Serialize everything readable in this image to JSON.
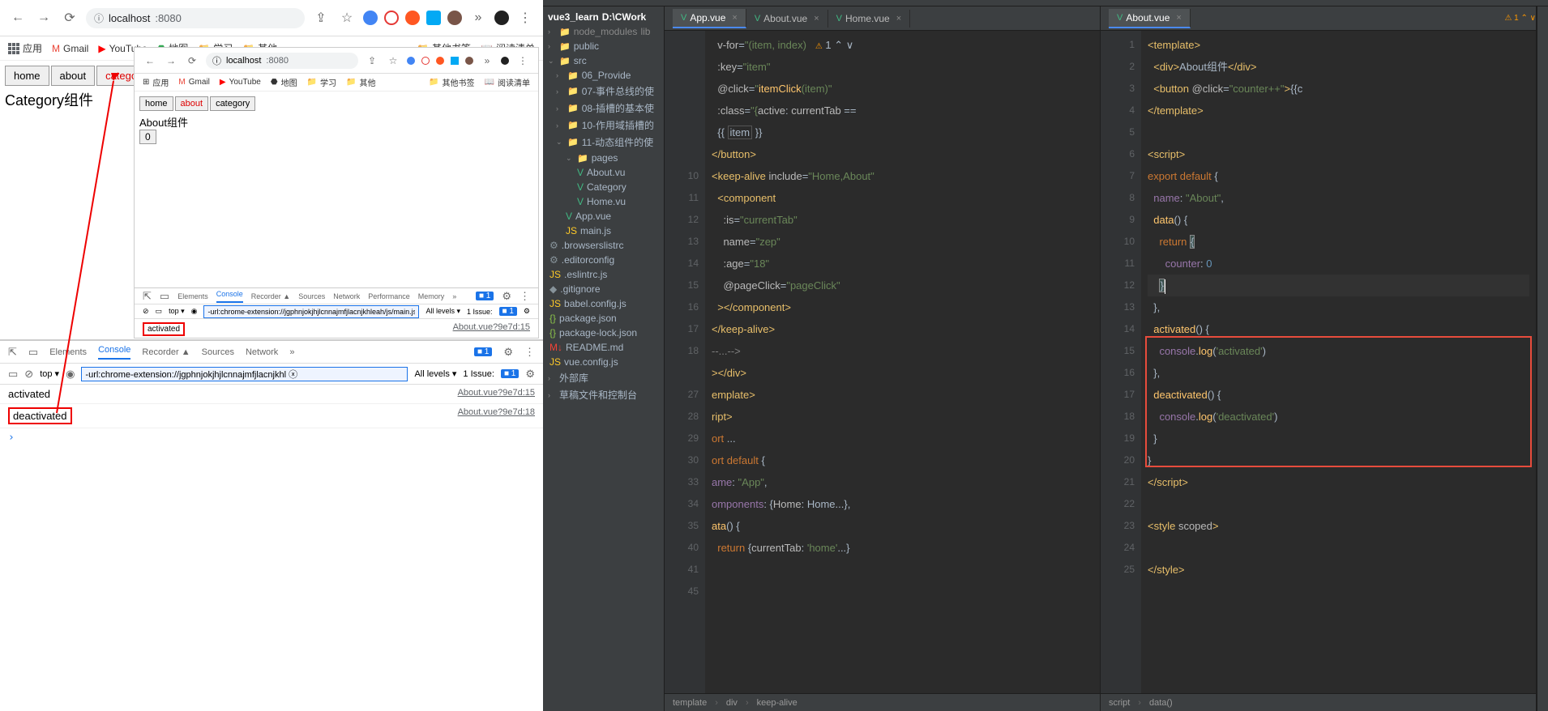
{
  "browser1": {
    "url_prefix": "localhost",
    "url_port": ":8080",
    "info_icon": "ⓘ",
    "bookmarks": {
      "apps": "应用",
      "gmail": "Gmail",
      "youtube": "YouTube",
      "maps": "地图",
      "study": "学习",
      "other": "其他",
      "other_bookmarks": "其他书签",
      "reading_list": "阅读清单"
    },
    "tabs": {
      "home": "home",
      "about": "about",
      "category": "category"
    },
    "page_title": "Category组件"
  },
  "browser2": {
    "url_prefix": "localhost",
    "url_port": ":8080",
    "tabs": {
      "home": "home",
      "about": "about",
      "category": "category"
    },
    "page_title": "About组件",
    "counter": "0",
    "devtools": {
      "tabs": [
        "Elements",
        "Console",
        "Recorder ▲",
        "Sources",
        "Network",
        "Performance",
        "Memory",
        "»"
      ],
      "filter": "-url:chrome-extension://jgphnjokjhjlcnnajmfjlacnjkhleah/js/main.js -url ⓧ",
      "levels": "All levels ▾",
      "issue": "1 Issue:",
      "top": "top ▾",
      "log1": "activated",
      "link1": "About.vue?9e7d:15"
    }
  },
  "devtools_main": {
    "tabs": {
      "elements": "Elements",
      "console": "Console",
      "recorder": "Recorder ▲",
      "sources": "Sources",
      "network": "Network",
      "more": "»"
    },
    "top": "top ▾",
    "filter": "-url:chrome-extension://jgphnjokjhjlcnnajmfjlacnjkhl ⓧ",
    "levels": "All levels ▾",
    "issue": "1 Issue:",
    "issue_count": "1",
    "log1": "activated",
    "log2": "deactivated",
    "link1": "About.vue?9e7d:15",
    "link2": "About.vue?9e7d:18",
    "msg_count": "1"
  },
  "ide": {
    "tabs": [
      {
        "name": "App.vue",
        "active": true
      },
      {
        "name": "About.vue",
        "active": false
      },
      {
        "name": "Home.vue",
        "active": false
      },
      {
        "name": "About.vue",
        "active": true
      }
    ],
    "tree": {
      "root": "vue3_learn",
      "root_path": "D:\\CWork",
      "node_modules": "node_modules",
      "lib": "lib",
      "public": "public",
      "src": "src",
      "folders": [
        "06_Provide",
        "07-事件总线的使",
        "08-插槽的基本使",
        "10-作用域插槽的",
        "11-动态组件的使"
      ],
      "pages": "pages",
      "pages_files": [
        "About.vu",
        "Category",
        "Home.vu"
      ],
      "app_vue": "App.vue",
      "main_js": "main.js",
      "browserslist": ".browserslistrc",
      "editorconfig": ".editorconfig",
      "eslintrc": ".eslintrc.js",
      "gitignore": ".gitignore",
      "babel": "babel.config.js",
      "package": "package.json",
      "package_lock": "package-lock.json",
      "readme": "README.md",
      "vueconfig": "vue.config.js",
      "external": "外部库",
      "scratch": "草稿文件和控制台"
    },
    "editor1": {
      "line_numbers": [
        "",
        "",
        "",
        "",
        "",
        "",
        "10",
        "11",
        "12",
        "13",
        "14",
        "15",
        "16",
        "17",
        "18",
        "",
        "27",
        "28",
        "29",
        "30",
        "33",
        "34",
        "35",
        "40",
        "41",
        "45"
      ],
      "breadcrumb": [
        "template",
        "div",
        "keep-alive"
      ]
    },
    "editor2": {
      "line_numbers": [
        "1",
        "2",
        "3",
        "4",
        "5",
        "6",
        "7",
        "8",
        "9",
        "10",
        "11",
        "12",
        "13",
        "14",
        "15",
        "16",
        "17",
        "18",
        "19",
        "20",
        "21",
        "22",
        "23",
        "24",
        "25"
      ],
      "breadcrumb": [
        "script",
        "data()"
      ],
      "warning": "⚠ 1 ⌃ ∨"
    }
  }
}
